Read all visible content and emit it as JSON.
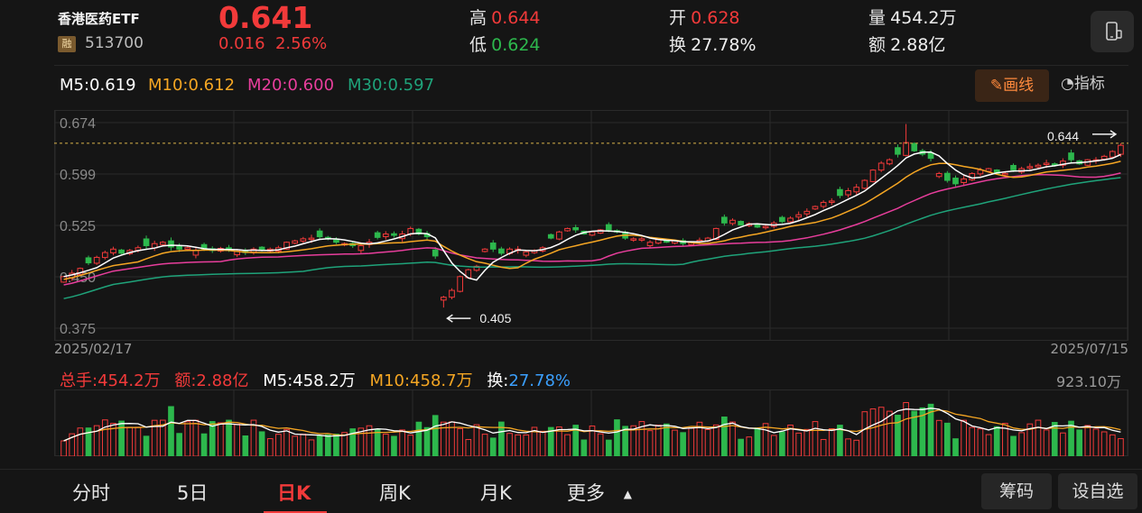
{
  "header": {
    "name": "香港医药ETF",
    "badge": "融",
    "code": "513700",
    "price": "0.641",
    "change": "0.016",
    "change_pct": "2.56%",
    "high_label": "高",
    "high": "0.644",
    "low_label": "低",
    "low": "0.624",
    "open_label": "开",
    "open": "0.628",
    "turnover_label": "换",
    "turnover": "27.78%",
    "volume_label": "量",
    "volume": "454.2万",
    "amount_label": "额",
    "amount": "2.88亿"
  },
  "ma": {
    "m5": "M5:0.619",
    "m10": "M10:0.612",
    "m20": "M20:0.600",
    "m30": "M30:0.597",
    "draw_label": "画线",
    "indicator_label": "指标"
  },
  "colors": {
    "up": "#f23a3a",
    "down": "#2db84d",
    "m5": "#ffffff",
    "m10": "#f5a623",
    "m20": "#e83e9c",
    "m30": "#1fa37a"
  },
  "kchart": {
    "y_ticks": [
      "0.674",
      "0.599",
      "0.525",
      "0.450",
      "0.375"
    ],
    "high_marker": "0.644",
    "low_marker": "0.405",
    "start_date": "2025/02/17",
    "end_date": "2025/07/15"
  },
  "volume": {
    "total": "总手:454.2万",
    "amount": "额:2.88亿",
    "m5": "M5:458.2万",
    "m10": "M10:458.7万",
    "turnover_label": "换:",
    "turnover": "27.78%",
    "max": "923.10万"
  },
  "tabs": [
    "分时",
    "5日",
    "日K",
    "周K",
    "月K",
    "更多"
  ],
  "buttons": {
    "chips": "筹码",
    "watchlist": "设自选"
  },
  "chart_data": {
    "type": "candlestick",
    "ylim": [
      0.375,
      0.674
    ],
    "start": "2025/02/17",
    "end": "2025/07/15",
    "high": 0.644,
    "low": 0.405,
    "close": [
      0.45,
      0.455,
      0.462,
      0.47,
      0.478,
      0.485,
      0.49,
      0.484,
      0.488,
      0.492,
      0.495,
      0.498,
      0.5,
      0.493,
      0.49,
      0.492,
      0.488,
      0.49,
      0.488,
      0.491,
      0.49,
      0.487,
      0.485,
      0.49,
      0.488,
      0.49,
      0.492,
      0.5,
      0.502,
      0.505,
      0.506,
      0.508,
      0.505,
      0.5,
      0.498,
      0.495,
      0.495,
      0.5,
      0.507,
      0.512,
      0.51,
      0.512,
      0.52,
      0.512,
      0.508,
      0.48,
      0.42,
      0.43,
      0.45,
      0.46,
      0.465,
      0.49,
      0.49,
      0.484,
      0.49,
      0.49,
      0.486,
      0.488,
      0.492,
      0.506,
      0.515,
      0.52,
      0.518,
      0.512,
      0.515,
      0.518,
      0.518,
      0.515,
      0.506,
      0.505,
      0.505,
      0.5,
      0.504,
      0.5,
      0.502,
      0.498,
      0.5,
      0.503,
      0.506,
      0.52,
      0.528,
      0.532,
      0.525,
      0.527,
      0.522,
      0.523,
      0.528,
      0.53,
      0.535,
      0.54,
      0.545,
      0.552,
      0.558,
      0.56,
      0.568,
      0.575,
      0.58,
      0.59,
      0.605,
      0.615,
      0.62,
      0.628,
      0.645,
      0.633,
      0.628,
      0.622,
      0.6,
      0.59,
      0.585,
      0.592,
      0.6,
      0.605,
      0.607,
      0.6,
      0.6,
      0.605,
      0.607,
      0.61,
      0.612,
      0.615,
      0.612,
      0.618,
      0.62,
      0.614,
      0.62,
      0.62,
      0.625,
      0.632,
      0.641
    ],
    "volume_max": "923.10万"
  }
}
